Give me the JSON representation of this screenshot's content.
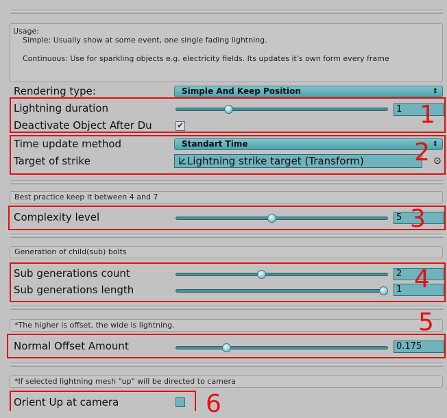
{
  "usage_help": {
    "line1": "Usage:",
    "line2": "Simple: Usually show at some event, one single fading lightning.",
    "line3": "Continuous: Use for sparkling objects e.g. electricity fields. Its updates it's own form every frame"
  },
  "rendering_type": {
    "label": "Rendering type:",
    "value": "Simple And Keep Position",
    "arrow": "⇕"
  },
  "lightning_duration": {
    "label": "Lightning duration",
    "value": "1",
    "slider_fraction": 0.24
  },
  "deactivate_object": {
    "label": "Deactivate Object After Du",
    "checked": "✔"
  },
  "time_update_method": {
    "label": "Time update method",
    "value": "Standart Time",
    "arrow": "⇕"
  },
  "target_of_strike": {
    "label": "Target of strike",
    "value": "Lightning strike target (Transform)",
    "picker": "⊙"
  },
  "complexity_help": "Best practice keep it between 4 and 7",
  "complexity_level": {
    "label": "Complexity level",
    "value": "5",
    "slider_fraction": 0.45
  },
  "generation_help": "Generation of child(sub) bolts",
  "sub_generations_count": {
    "label": "Sub generations count",
    "value": "2",
    "slider_fraction": 0.4
  },
  "sub_generations_length": {
    "label": "Sub generations length",
    "value": "1",
    "slider_fraction": 1.0
  },
  "offset_help": "*The higher is offset, the wide is lightning.",
  "normal_offset_amount": {
    "label": "Normal Offset Amount",
    "value": "0.175",
    "slider_fraction": 0.23
  },
  "orient_help": "*If selected lightning mesh \"up\" will be directed to camera",
  "orient_up_at_camera": {
    "label": "Orient Up at camera"
  },
  "annotations": [
    "1",
    "2",
    "3",
    "4",
    "5",
    "6"
  ],
  "colors": {
    "accent": "#6fb3bd",
    "annotation": "#e61010",
    "background": "#c2c2c2"
  }
}
